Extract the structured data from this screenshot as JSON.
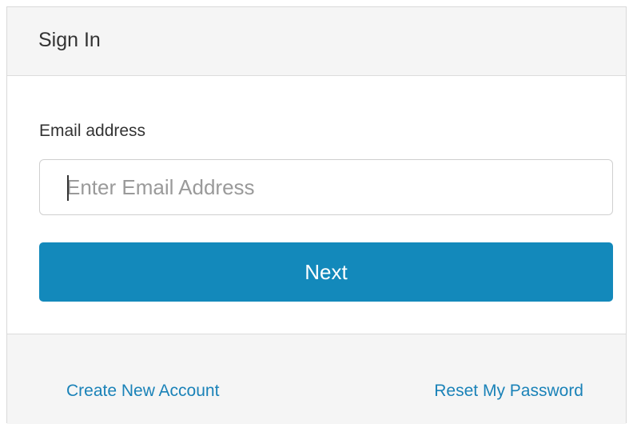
{
  "header": {
    "title": "Sign In"
  },
  "form": {
    "email_label": "Email address",
    "email_value": "",
    "email_placeholder": "Enter Email Address",
    "next_label": "Next"
  },
  "footer": {
    "create_account_label": "Create New Account",
    "reset_password_label": "Reset My Password"
  },
  "colors": {
    "accent": "#1389bb",
    "link": "#1a82b8",
    "panel_bg": "#f5f5f5"
  }
}
